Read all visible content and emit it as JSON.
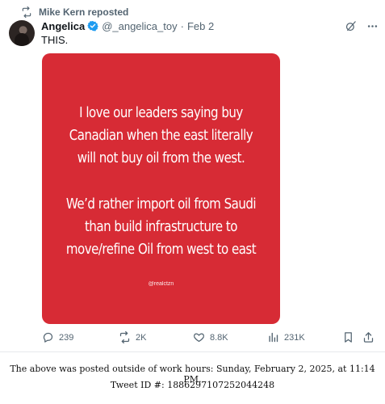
{
  "repost": {
    "label": "Mike Kern reposted",
    "icon": "repost-icon"
  },
  "author": {
    "name": "Angelica",
    "handle": "@_angelica_toy",
    "separator": "·",
    "date": "Feb 2",
    "verified_icon": "verified-badge-icon"
  },
  "tweet": {
    "text": "THIS."
  },
  "media": {
    "background": "#d72b35",
    "lines": [
      "I love our leaders saying buy",
      "Canadian when the east literally",
      "will not buy oil from the west.",
      "We’d rather import oil from Saudi",
      "than build infrastructure to",
      "move/refine Oil from west to east"
    ],
    "handle": "@realctzn"
  },
  "actions": {
    "replies": "239",
    "reposts": "2K",
    "likes": "8.8K",
    "views": "231K"
  },
  "footer": {
    "line1": "The above was posted outside of work hours: Sunday, February 2, 2025, at 11:14 PM.",
    "line2": "Tweet ID #: 1886297107252044248"
  }
}
